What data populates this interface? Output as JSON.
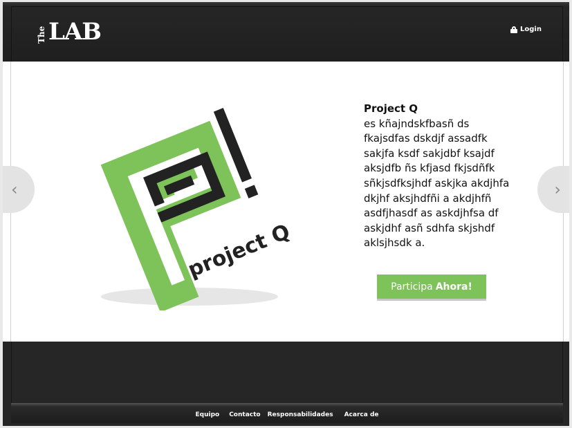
{
  "header": {
    "logo_small": "The",
    "logo_large": "LAB",
    "login_label": "Login"
  },
  "carousel": {
    "prev_glyph": "‹",
    "next_glyph": "›",
    "logo_text": "project Q",
    "brand_green": "#7dc35a",
    "brand_dark": "#222222"
  },
  "project": {
    "title": "Project Q",
    "description": "es kñajndskfbasñ ds fkajsdfas dskdjf assadfk sakjfa ksdf sakjdbf ksajdf aksjdfb ñs kfjasd fkjsdñfk sñkjsdfksjhdf askjka akdjhfa dkjhf aksjhdfñi a akdjhfñ asdfjhasdf as askdjhfsa df askjdhf asñ sdhfa skjshdf aklsjhsdk a.",
    "cta_light": "Participa",
    "cta_bold": "Ahora!"
  },
  "footer": {
    "links": [
      "Equipo",
      "Contacto",
      "Responsabilidades",
      "Acarca de"
    ]
  }
}
